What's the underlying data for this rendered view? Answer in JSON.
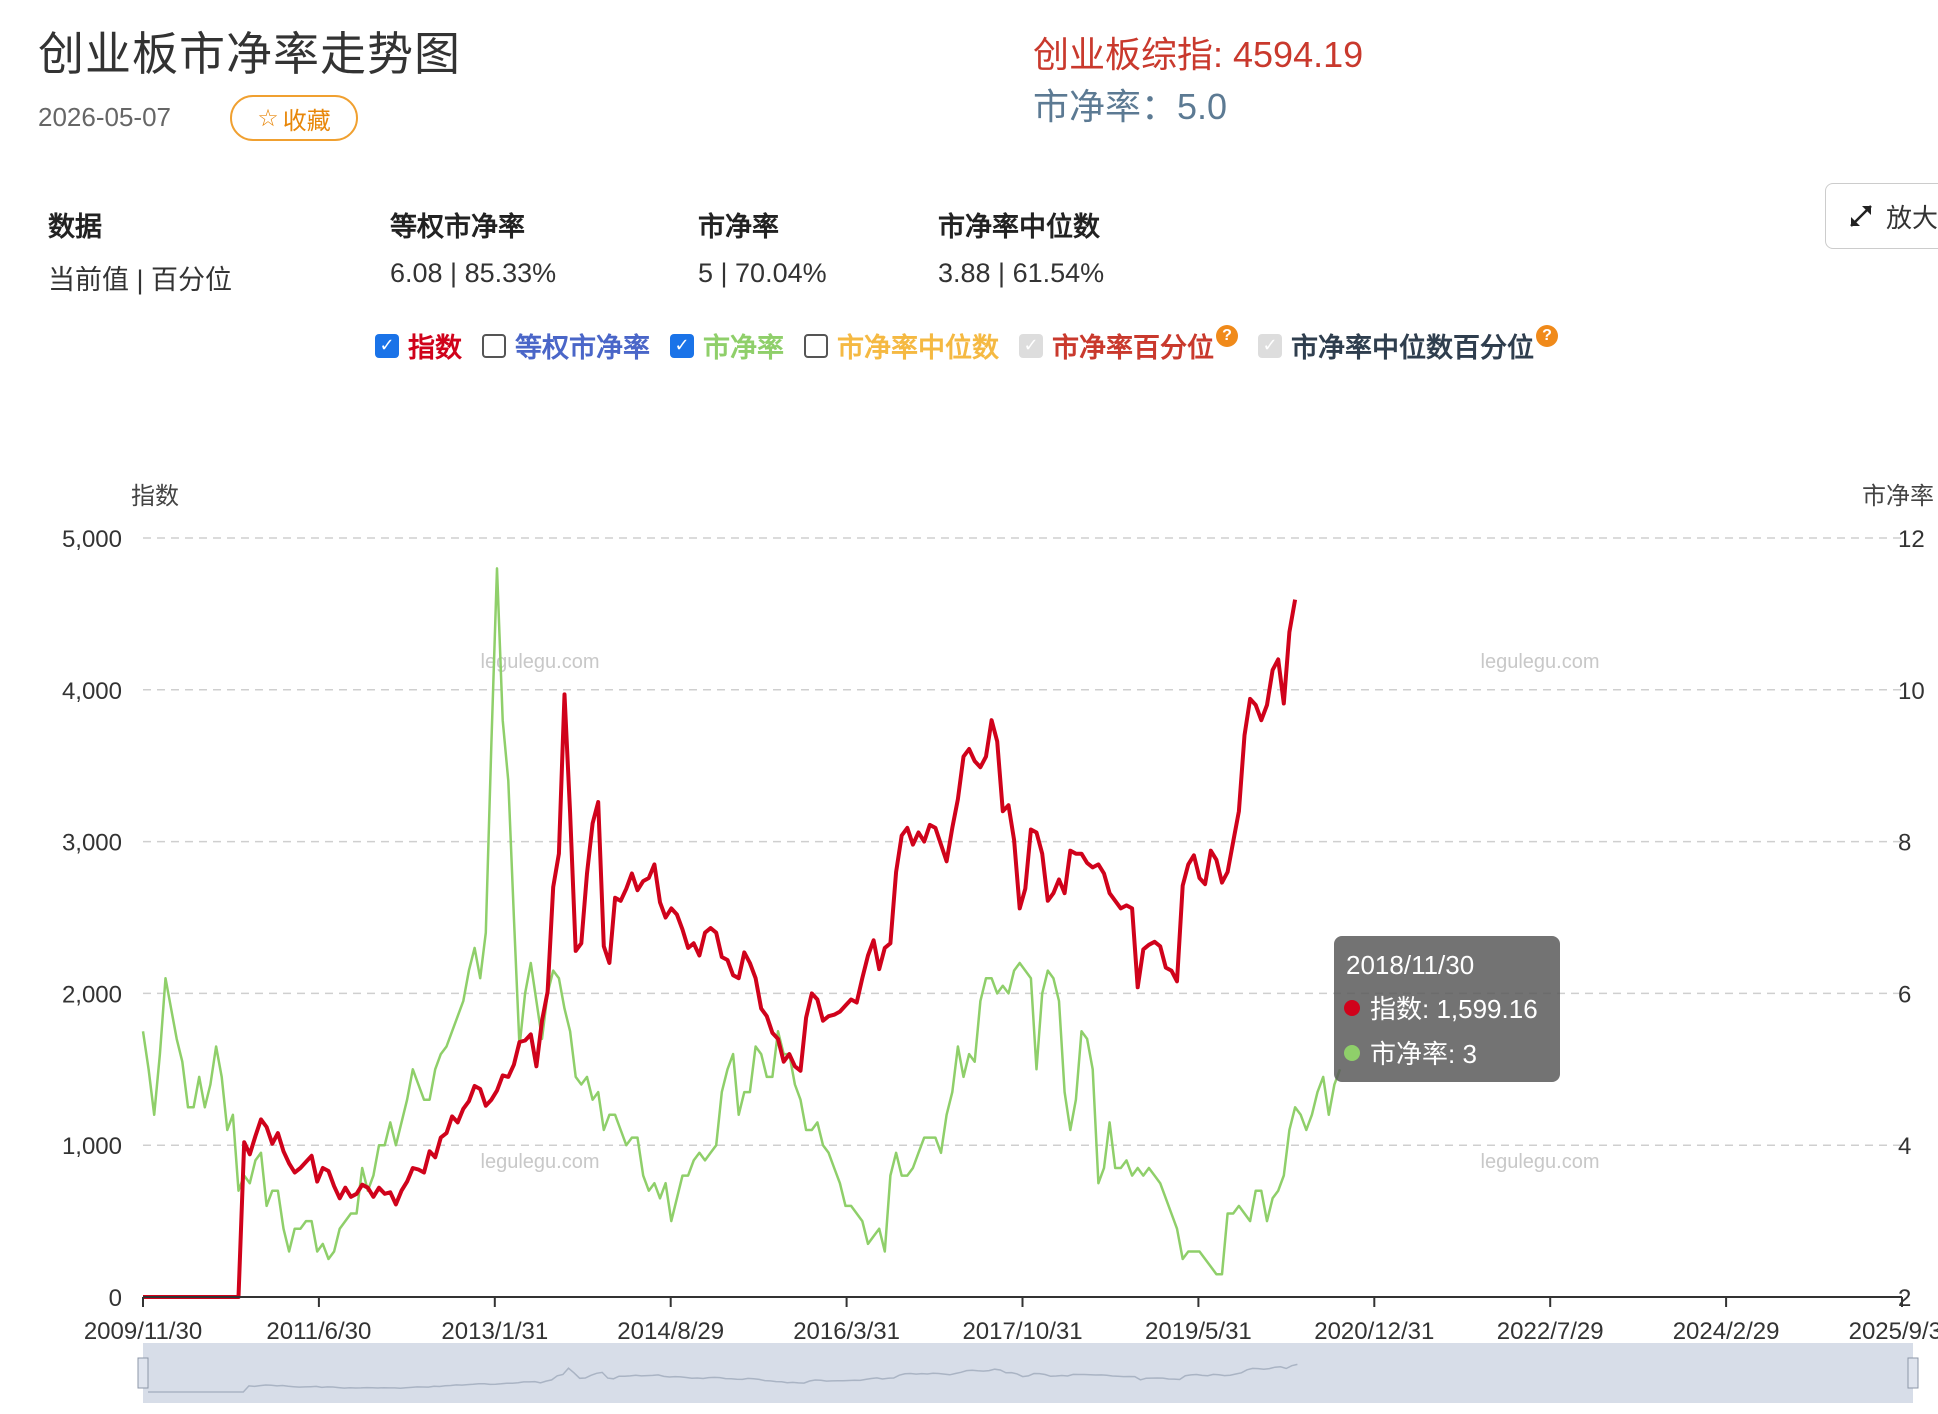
{
  "header": {
    "title": "创业板市净率走势图",
    "date": "2026-05-07",
    "favorite_label": "收藏",
    "index_line": "创业板综指: 4594.19",
    "pb_line": "市净率：5.0",
    "zoom_label": "放大"
  },
  "stats": [
    {
      "label": "数据",
      "value": "当前值 | 百分位"
    },
    {
      "label": "等权市净率",
      "value": "6.08 | 85.33%"
    },
    {
      "label": "市净率",
      "value": "5 | 70.04%"
    },
    {
      "label": "市净率中位数",
      "value": "3.88 | 61.54%"
    }
  ],
  "legend": [
    {
      "label": "指数",
      "state": "checked",
      "color": "#d0021b"
    },
    {
      "label": "等权市净率",
      "state": "unchecked",
      "color": "#4a66c8"
    },
    {
      "label": "市净率",
      "state": "checked",
      "color": "#8fcf6a"
    },
    {
      "label": "市净率中位数",
      "state": "unchecked",
      "color": "#f5b942"
    },
    {
      "label": "市净率百分位",
      "state": "disabled",
      "color": "#c9392d",
      "help": "?"
    },
    {
      "label": "市净率中位数百分位",
      "state": "disabled",
      "color": "#2f3e4e",
      "help": "?"
    }
  ],
  "tooltip": {
    "date": "2018/11/30",
    "index": "指数: 1,599.16",
    "pb": "市净率: 3"
  },
  "watermark": "legulegu.com",
  "chart_data": {
    "type": "line",
    "left_axis_label": "指数",
    "right_axis_label": "市净率",
    "left_ticks": [
      "5,000",
      "4,000",
      "3,000",
      "2,000",
      "1,000",
      "0"
    ],
    "right_ticks": [
      "12",
      "10",
      "8",
      "6",
      "4",
      "2"
    ],
    "x_ticks": [
      "2009/11/30",
      "2011/6/30",
      "2013/1/31",
      "2014/8/29",
      "2016/3/31",
      "2017/10/31",
      "2019/5/31",
      "2020/12/31",
      "2022/7/29",
      "2024/2/29",
      "2025/9/30"
    ],
    "ylim_left": [
      0,
      5000
    ],
    "ylim_right": [
      2,
      12
    ],
    "grid": true,
    "x": [
      0,
      0.25,
      0.5,
      0.75,
      1,
      1.5,
      1.75,
      2,
      2.25,
      2.5,
      2.75,
      3,
      3.25,
      3.5,
      3.75,
      4,
      4.25,
      4.5,
      4.75,
      5,
      5.25,
      5.5,
      5.75,
      6,
      6.25,
      6.5,
      6.75,
      7,
      7.25,
      7.5,
      7.75,
      8,
      8.25,
      8.5,
      8.75,
      9,
      9.25,
      9.5,
      9.75,
      10,
      10.25,
      10.5,
      10.75,
      11,
      11.25,
      11.5,
      11.75,
      12,
      12.25,
      12.5,
      12.75,
      13,
      13.25,
      13.5,
      13.75,
      14,
      14.25,
      14.5,
      14.75,
      15,
      15.25,
      15.5,
      15.75,
      16,
      16.25,
      16.5,
      16.75,
      17,
      17.25,
      17.5,
      17.75,
      18,
      18.25,
      18.5,
      18.75,
      19,
      19.25,
      19.5,
      19.75,
      20,
      20.25,
      20.5,
      20.75,
      21,
      21.25,
      21.5,
      21.75,
      22,
      22.25,
      22.5,
      22.75,
      23,
      23.25,
      23.5,
      23.75,
      24,
      24.25,
      24.5,
      24.75,
      25,
      25.25,
      25.5,
      25.75,
      26,
      26.25,
      26.5,
      26.75,
      27,
      27.25,
      27.5,
      27.75,
      28,
      28.25,
      28.5,
      28.75,
      29,
      29.25,
      29.5,
      29.75,
      30,
      30.25,
      30.5,
      30.75,
      31,
      31.25,
      31.5,
      31.75,
      32,
      32.25,
      32.5,
      32.75,
      33,
      33.25,
      33.5,
      33.75,
      34,
      34.25,
      34.5,
      34.75,
      35,
      35.25,
      35.5,
      35.75,
      36,
      36.25,
      36.5,
      36.75,
      37,
      37.25,
      37.5,
      37.75,
      38,
      38.25,
      38.5,
      38.75,
      39,
      39.25,
      39.5,
      39.75,
      40,
      40.25,
      40.5,
      40.75,
      41,
      41.25,
      41.5,
      41.75,
      42,
      42.25,
      42.5,
      42.75,
      43,
      43.25,
      43.5,
      43.75,
      44,
      44.25,
      44.5,
      44.75,
      45,
      45.25,
      45.5,
      45.75,
      46,
      46.25,
      46.5,
      46.75,
      47,
      47.25,
      47.5,
      47.75,
      48,
      48.25,
      48.5,
      48.75,
      49,
      49.25,
      49.5,
      49.75,
      50,
      50.25,
      50.5,
      50.75,
      51,
      51.25,
      51.5,
      51.75,
      52,
      52.25,
      52.5,
      52.75,
      53,
      53.25,
      53.5,
      53.75,
      54,
      54.25,
      54.5,
      54.75,
      55,
      55.25,
      55.5,
      55.75,
      56,
      56.25,
      56.5,
      56.75,
      57,
      57.25,
      57.5,
      57.75,
      58,
      58.25,
      58.5,
      58.75,
      59,
      59.25,
      59.5,
      59.75,
      60,
      60.25,
      60.5,
      60.75,
      61,
      61.25,
      61.5,
      61.75,
      62,
      62.25,
      62.5,
      62.75,
      63,
      63.25,
      63.5,
      63.75,
      64,
      64.25,
      64.5,
      64.75,
      65,
      65.25,
      65.5,
      65.75,
      66,
      66.25,
      66.5,
      66.75,
      67,
      67.25,
      67.5,
      67.75,
      68,
      68.25,
      68.5,
      68.75,
      69,
      69.25,
      69.5,
      69.75,
      70,
      70.25,
      70.5,
      70.75,
      71,
      71.25,
      71.5,
      71.75,
      72,
      72.25,
      72.5,
      72.75,
      73,
      73.25,
      73.5,
      73.75,
      74,
      74.25,
      74.5,
      74.75,
      75,
      75.25,
      75.5,
      75.75,
      76,
      76.25,
      76.5,
      76.75,
      77,
      77.25,
      77.5,
      77.75,
      78,
      78.25
    ],
    "series": [
      {
        "name": "指数",
        "axis": "left",
        "color": "#d0021b",
        "values": [
          0,
          0,
          0,
          0,
          0,
          0,
          0,
          0,
          0,
          0,
          0,
          0,
          0,
          0,
          0,
          0,
          0,
          1020,
          940,
          1060,
          1170,
          1120,
          1010,
          1080,
          960,
          880,
          820,
          850,
          890,
          930,
          760,
          850,
          830,
          730,
          650,
          720,
          660,
          680,
          740,
          720,
          660,
          720,
          680,
          690,
          610,
          700,
          760,
          850,
          840,
          820,
          960,
          920,
          1050,
          1080,
          1190,
          1150,
          1240,
          1290,
          1390,
          1370,
          1260,
          1300,
          1360,
          1460,
          1450,
          1530,
          1680,
          1690,
          1730,
          1520,
          1820,
          2010,
          2700,
          2920,
          3970,
          3190,
          2280,
          2330,
          2790,
          3120,
          3260,
          2310,
          2200,
          2630,
          2610,
          2690,
          2790,
          2680,
          2740,
          2760,
          2850,
          2600,
          2500,
          2560,
          2520,
          2420,
          2300,
          2330,
          2250,
          2400,
          2430,
          2400,
          2240,
          2220,
          2120,
          2100,
          2270,
          2200,
          2100,
          1900,
          1850,
          1740,
          1700,
          1550,
          1600,
          1520,
          1490,
          1840,
          2000,
          1960,
          1820,
          1850,
          1860,
          1880,
          1920,
          1960,
          1940,
          2100,
          2250,
          2350,
          2160,
          2300,
          2330,
          2800,
          3040,
          3090,
          2980,
          3060,
          3000,
          3110,
          3090,
          2980,
          2870,
          3090,
          3280,
          3560,
          3610,
          3530,
          3490,
          3560,
          3800,
          3660,
          3200,
          3240,
          3010,
          2560,
          2690,
          3080,
          3060,
          2920,
          2610,
          2660,
          2750,
          2660,
          2940,
          2920,
          2920,
          2860,
          2830,
          2850,
          2790,
          2660,
          2610,
          2560,
          2580,
          2560,
          2040,
          2290,
          2320,
          2340,
          2310,
          2170,
          2150,
          2080,
          2710,
          2850,
          2910,
          2760,
          2720,
          2940,
          2880,
          2730,
          2800,
          3000,
          3200,
          3700,
          3940,
          3900,
          3800,
          3900,
          4130,
          4200,
          3910,
          4380,
          4594.19
        ]
      },
      {
        "name": "市净率",
        "axis": "right",
        "color": "#8fcf6a",
        "values": [
          5.5,
          5.0,
          4.4,
          5.2,
          6.2,
          5.4,
          5.1,
          4.5,
          4.5,
          4.9,
          4.5,
          4.8,
          5.3,
          4.9,
          4.2,
          4.4,
          3.4,
          3.6,
          3.5,
          3.8,
          3.9,
          3.2,
          3.4,
          3.4,
          2.9,
          2.6,
          2.9,
          2.9,
          3.0,
          3.0,
          2.6,
          2.7,
          2.5,
          2.6,
          2.9,
          3.0,
          3.1,
          3.1,
          3.7,
          3.4,
          3.6,
          4.0,
          4.0,
          4.3,
          4.0,
          4.3,
          4.6,
          5.0,
          4.8,
          4.6,
          4.6,
          5.0,
          5.2,
          5.3,
          5.5,
          5.7,
          5.9,
          6.3,
          6.6,
          6.2,
          6.8,
          9.3,
          11.6,
          9.6,
          8.8,
          7.0,
          5.3,
          6.0,
          6.4,
          5.9,
          5.4,
          6.0,
          6.3,
          6.2,
          5.8,
          5.5,
          4.9,
          4.8,
          4.9,
          4.6,
          4.7,
          4.2,
          4.4,
          4.4,
          4.2,
          4.0,
          4.1,
          4.1,
          3.6,
          3.4,
          3.5,
          3.3,
          3.5,
          3.0,
          3.3,
          3.6,
          3.6,
          3.8,
          3.9,
          3.8,
          3.9,
          4.0,
          4.7,
          5.0,
          5.2,
          4.4,
          4.7,
          4.7,
          5.3,
          5.2,
          4.9,
          4.9,
          5.5,
          5.2,
          5.2,
          4.8,
          4.6,
          4.2,
          4.2,
          4.3,
          4.0,
          3.9,
          3.7,
          3.5,
          3.2,
          3.2,
          3.1,
          3.0,
          2.7,
          2.8,
          2.9,
          2.6,
          3.6,
          3.9,
          3.6,
          3.6,
          3.7,
          3.9,
          4.1,
          4.1,
          4.1,
          3.9,
          4.4,
          4.7,
          5.3,
          4.9,
          5.2,
          5.1,
          5.9,
          6.2,
          6.2,
          6.0,
          6.1,
          6.0,
          6.3,
          6.4,
          6.3,
          6.2,
          5.0,
          6.0,
          6.3,
          6.2,
          5.9,
          4.7,
          4.2,
          4.6,
          5.5,
          5.4,
          5.0,
          3.5,
          3.7,
          4.3,
          3.7,
          3.7,
          3.8,
          3.6,
          3.7,
          3.6,
          3.7,
          3.6,
          3.5,
          3.3,
          3.1,
          2.9,
          2.5,
          2.6,
          2.6,
          2.6,
          2.5,
          2.4,
          2.3,
          2.3,
          3.1,
          3.1,
          3.2,
          3.1,
          3.0,
          3.4,
          3.4,
          3.0,
          3.3,
          3.4,
          3.6,
          4.2,
          4.5,
          4.4,
          4.2,
          4.4,
          4.7,
          4.9,
          4.4,
          4.8,
          5.0
        ]
      }
    ]
  }
}
